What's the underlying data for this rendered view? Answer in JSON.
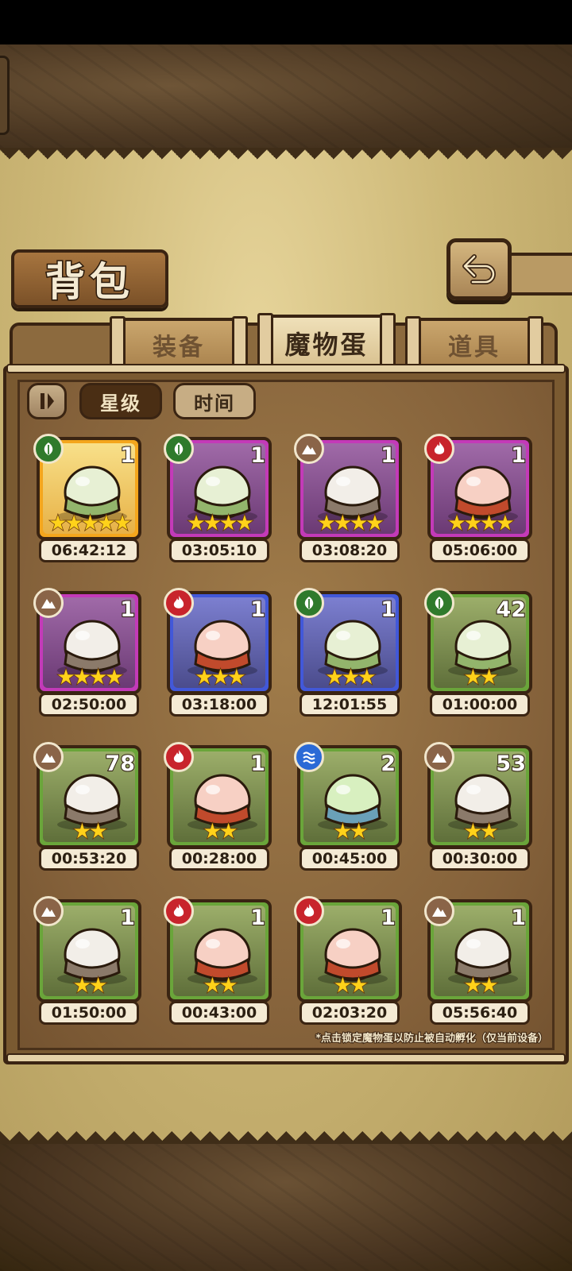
{
  "page": {
    "title": "背包"
  },
  "tabs": [
    {
      "label": "装备",
      "active": false
    },
    {
      "label": "魔物蛋",
      "active": true
    },
    {
      "label": "道具",
      "active": false
    }
  ],
  "sort_buttons": [
    {
      "label": "星级",
      "active": true
    },
    {
      "label": "时间",
      "active": false
    }
  ],
  "eggs": [
    {
      "element": "grass",
      "rarity": "gold",
      "count": "1",
      "stars": 5,
      "timer": "06:42:12"
    },
    {
      "element": "grass",
      "rarity": "purple",
      "count": "1",
      "stars": 4,
      "timer": "03:05:10"
    },
    {
      "element": "rock",
      "rarity": "purple",
      "count": "1",
      "stars": 4,
      "timer": "03:08:20"
    },
    {
      "element": "fire",
      "rarity": "purple",
      "count": "1",
      "stars": 4,
      "timer": "05:06:00"
    },
    {
      "element": "rock",
      "rarity": "purple",
      "count": "1",
      "stars": 4,
      "timer": "02:50:00"
    },
    {
      "element": "fire",
      "rarity": "blue",
      "count": "1",
      "stars": 3,
      "timer": "03:18:00"
    },
    {
      "element": "grass",
      "rarity": "blue",
      "count": "1",
      "stars": 3,
      "timer": "12:01:55"
    },
    {
      "element": "grass",
      "rarity": "green",
      "count": "42",
      "stars": 2,
      "timer": "01:00:00"
    },
    {
      "element": "rock",
      "rarity": "green",
      "count": "78",
      "stars": 2,
      "timer": "00:53:20"
    },
    {
      "element": "fire",
      "rarity": "green",
      "count": "1",
      "stars": 2,
      "timer": "00:28:00"
    },
    {
      "element": "water",
      "rarity": "green",
      "count": "2",
      "stars": 2,
      "timer": "00:45:00"
    },
    {
      "element": "rock",
      "rarity": "green",
      "count": "53",
      "stars": 2,
      "timer": "00:30:00"
    },
    {
      "element": "rock",
      "rarity": "green",
      "count": "1",
      "stars": 2,
      "timer": "01:50:00"
    },
    {
      "element": "fire",
      "rarity": "green",
      "count": "1",
      "stars": 2,
      "timer": "00:43:00"
    },
    {
      "element": "fire",
      "rarity": "green",
      "count": "1",
      "stars": 2,
      "timer": "02:03:20"
    },
    {
      "element": "rock",
      "rarity": "green",
      "count": "1",
      "stars": 2,
      "timer": "05:56:40"
    }
  ],
  "footnote": "*点击锁定魔物蛋以防止被自动孵化（仅当前设备）",
  "colors": {
    "grass": "#2f7a2c",
    "rock": "#8a6448",
    "fire": "#c8242c",
    "water": "#2b6ad6",
    "rarity_gold": "#f4a61d",
    "rarity_purple": "#c33ab8",
    "rarity_blue": "#4258d8",
    "rarity_green": "#6aa53a"
  },
  "icons": {
    "grass": "leaf-icon",
    "rock": "mountain-icon",
    "fire": "flame-icon",
    "water": "wave-icon",
    "back": "return-arrow-icon",
    "filter": "filter-toggle-icon",
    "star": "star-icon"
  }
}
